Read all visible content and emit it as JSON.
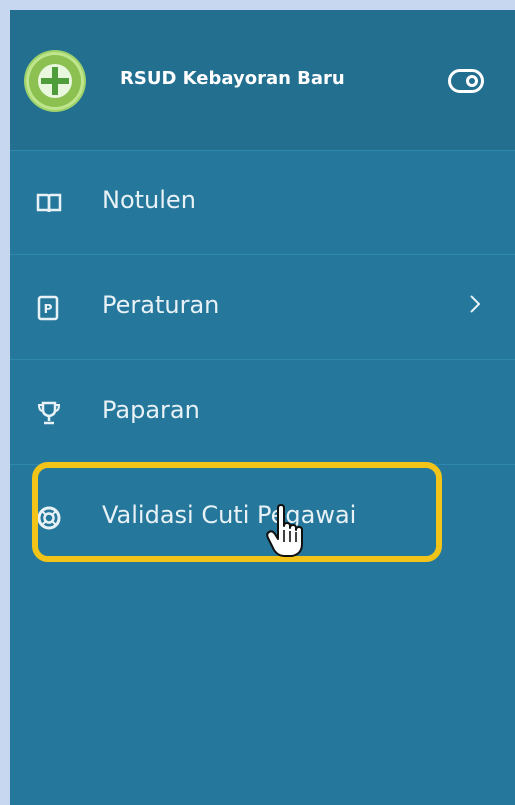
{
  "sidebar": {
    "app_name": "RSUD Kebayoran Baru",
    "items": [
      {
        "label": "Notulen",
        "icon": "book-icon"
      },
      {
        "label": "Peraturan",
        "icon": "document-p-icon",
        "has_submenu": true
      },
      {
        "label": "Paparan",
        "icon": "trophy-icon"
      },
      {
        "label": "Validasi Cuti Pegawai",
        "icon": "lifebuoy-icon",
        "highlighted": true
      }
    ]
  },
  "colors": {
    "panel": "#25789b",
    "header": "#226f90",
    "highlight": "#f2c318",
    "page_background": "#c6d7ef"
  }
}
